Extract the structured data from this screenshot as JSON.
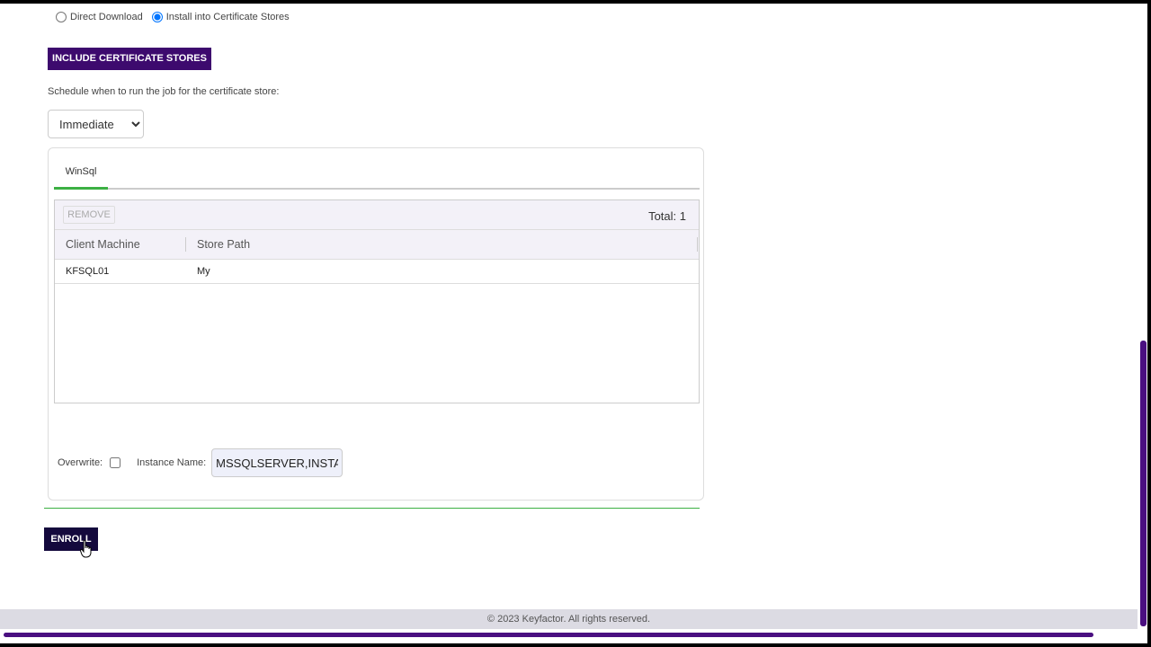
{
  "delivery": {
    "option_download": "Direct Download",
    "option_install": "Install into Certificate Stores"
  },
  "include_button": "INCLUDE CERTIFICATE STORES",
  "schedule": {
    "label": "Schedule when to run the job for the certificate store:",
    "selected": "Immediate"
  },
  "tabs": [
    {
      "label": "WinSql"
    }
  ],
  "grid": {
    "remove_label": "REMOVE",
    "total_text": "Total: 1",
    "columns": [
      "Client Machine",
      "Store Path"
    ],
    "rows": [
      {
        "client_machine": "KFSQL01",
        "store_path": "My"
      }
    ]
  },
  "options": {
    "overwrite_label": "Overwrite:",
    "instance_label": "Instance Name:",
    "instance_value": "MSSQLSERVER,INSTANCE"
  },
  "enroll_button": "ENROLL",
  "footer": "© 2023 Keyfactor. All rights reserved.",
  "colors": {
    "primary_purple": "#3d0a6e",
    "enroll_navy": "#14093d",
    "accent_green": "#3cb043"
  }
}
